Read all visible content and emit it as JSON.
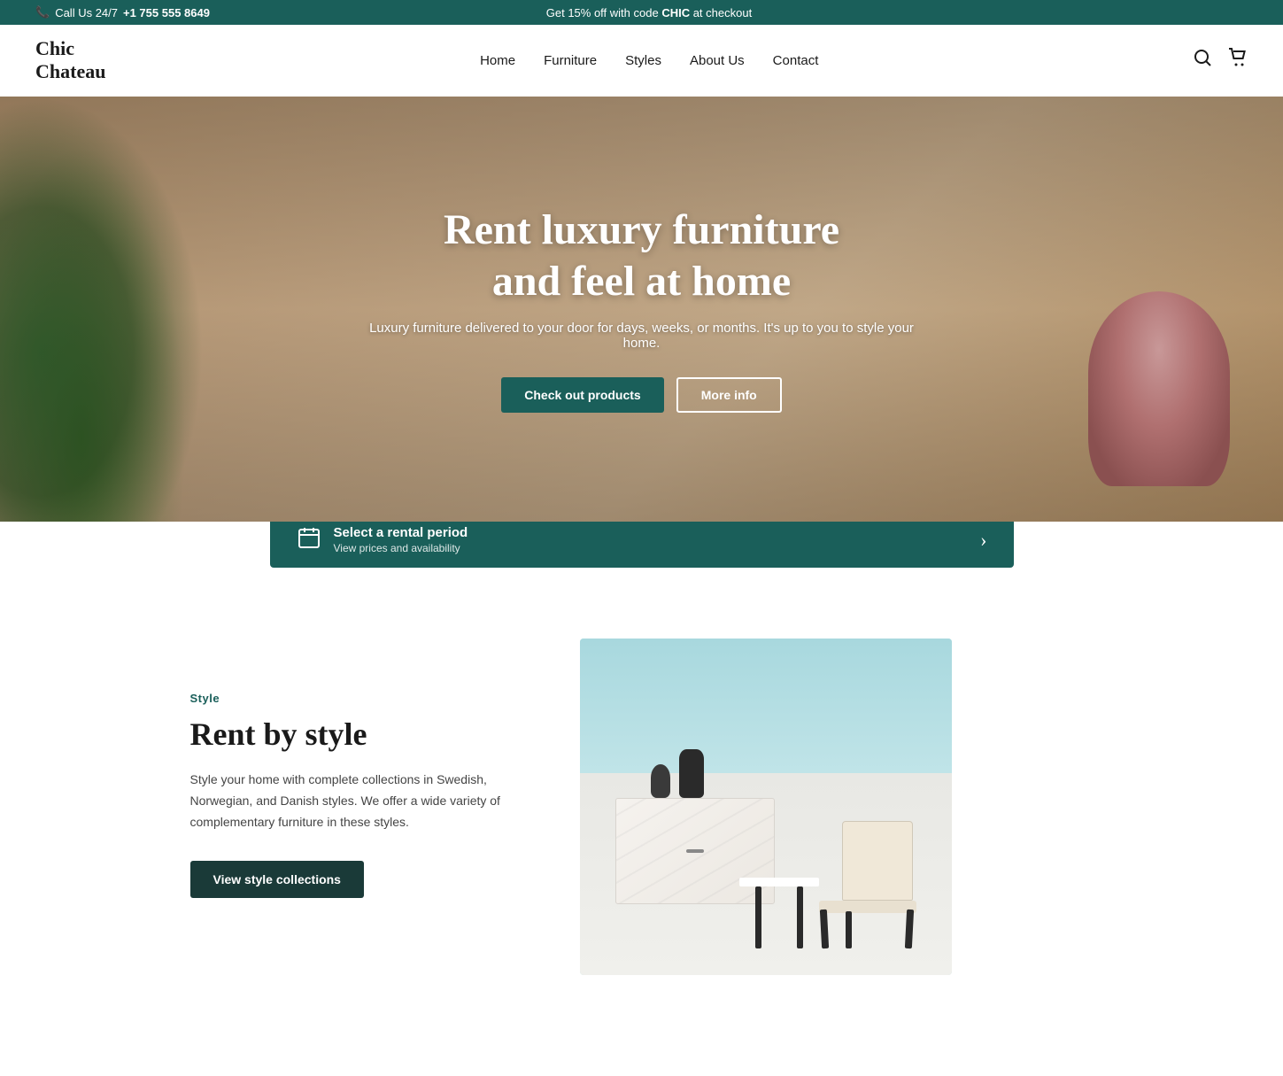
{
  "topbar": {
    "phone_icon": "📞",
    "call_text": "Call Us 24/7",
    "phone_number": "+1 755 555 8649",
    "promo_text": "Get 15% off with code ",
    "promo_code": "CHIC",
    "promo_suffix": " at checkout"
  },
  "header": {
    "logo_line1": "Chic",
    "logo_line2": "Chateau",
    "nav": {
      "home": "Home",
      "furniture": "Furniture",
      "styles": "Styles",
      "about": "About Us",
      "contact": "Contact"
    }
  },
  "hero": {
    "title_line1": "Rent luxury furniture",
    "title_line2": "and feel at home",
    "subtitle": "Luxury furniture delivered to your door for days, weeks, or months. It's up to you to style your home.",
    "btn_primary": "Check out products",
    "btn_secondary": "More info"
  },
  "rental_bar": {
    "title": "Select a rental period",
    "subtitle": "View prices and availability",
    "arrow": "›"
  },
  "style_section": {
    "tag": "Style",
    "title": "Rent by style",
    "description": "Style your home with complete collections in Swedish, Norwegian, and Danish styles. We offer a wide variety of complementary furniture in these styles.",
    "btn_label": "View style collections"
  }
}
